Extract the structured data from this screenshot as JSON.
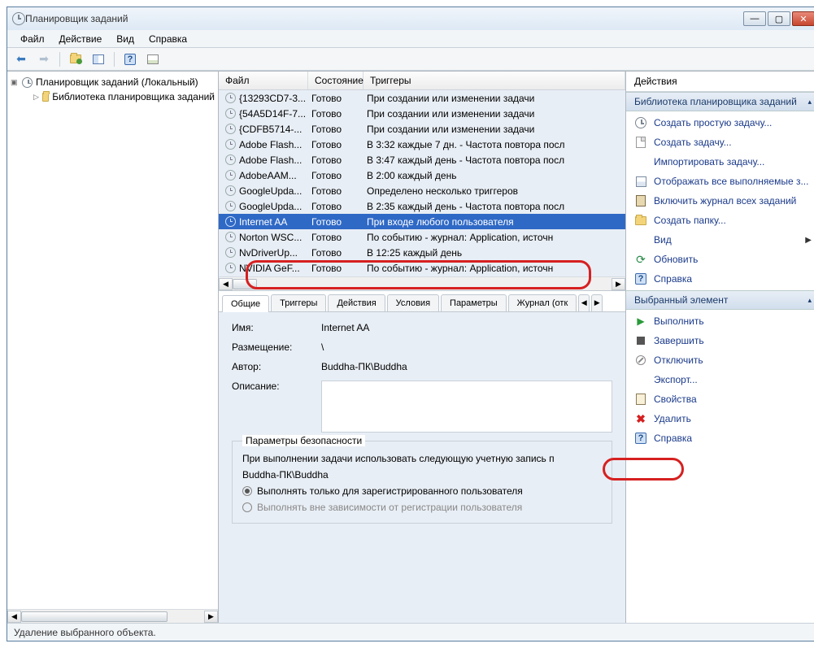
{
  "window": {
    "title": "Планировщик заданий"
  },
  "menu": {
    "file": "Файл",
    "action": "Действие",
    "view": "Вид",
    "help": "Справка"
  },
  "tree": {
    "root": "Планировщик заданий (Локальный)",
    "library": "Библиотека планировщика заданий"
  },
  "list": {
    "columns": {
      "file": "Файл",
      "state": "Состояние",
      "triggers": "Триггеры"
    },
    "rows": [
      {
        "file": "{13293CD7-3...",
        "state": "Готово",
        "trigger": "При создании или изменении задачи",
        "selected": false
      },
      {
        "file": "{54A5D14F-7...",
        "state": "Готово",
        "trigger": "При создании или изменении задачи",
        "selected": false
      },
      {
        "file": "{CDFB5714-...",
        "state": "Готово",
        "trigger": "При создании или изменении задачи",
        "selected": false
      },
      {
        "file": "Adobe Flash...",
        "state": "Готово",
        "trigger": "В 3:32 каждые 7 дн. - Частота повтора посл",
        "selected": false
      },
      {
        "file": "Adobe Flash...",
        "state": "Готово",
        "trigger": "В 3:47 каждый день - Частота повтора посл",
        "selected": false
      },
      {
        "file": "AdobeAAM...",
        "state": "Готово",
        "trigger": "В 2:00 каждый день",
        "selected": false
      },
      {
        "file": "GoogleUpda...",
        "state": "Готово",
        "trigger": "Определено несколько триггеров",
        "selected": false
      },
      {
        "file": "GoogleUpda...",
        "state": "Готово",
        "trigger": "В 2:35 каждый день - Частота повтора посл",
        "selected": false
      },
      {
        "file": "Internet AA",
        "state": "Готово",
        "trigger": "При входе любого пользователя",
        "selected": true
      },
      {
        "file": "Norton WSC...",
        "state": "Готово",
        "trigger": "По событию - журнал: Application, источн",
        "selected": false
      },
      {
        "file": "NvDriverUp...",
        "state": "Готово",
        "trigger": "В 12:25 каждый день",
        "selected": false
      },
      {
        "file": "NVIDIA GeF...",
        "state": "Готово",
        "trigger": "По событию - журнал: Application, источн",
        "selected": false
      }
    ]
  },
  "detail": {
    "tabs": [
      "Общие",
      "Триггеры",
      "Действия",
      "Условия",
      "Параметры",
      "Журнал (отк"
    ],
    "labels": {
      "name": "Имя:",
      "location": "Размещение:",
      "author": "Автор:",
      "description": "Описание:"
    },
    "values": {
      "name": "Internet AA",
      "location": "\\",
      "author": "Buddha-ПК\\Buddha"
    },
    "security": {
      "legend": "Параметры безопасности",
      "account_label": "При выполнении задачи использовать следующую учетную запись п",
      "account": "Buddha-ПК\\Buddha",
      "radio_logged_on": "Выполнять только для зарегистрированного пользователя",
      "radio_any": "Выполнять вне зависимости от регистрации пользователя"
    }
  },
  "actions": {
    "title": "Действия",
    "section_library": "Библиотека планировщика заданий",
    "section_selected": "Выбранный элемент",
    "library_items": [
      {
        "icon": "clock",
        "label": "Создать простую задачу..."
      },
      {
        "icon": "sheet-new",
        "label": "Создать задачу..."
      },
      {
        "icon": "none",
        "label": "Импортировать задачу..."
      },
      {
        "icon": "grid",
        "label": "Отображать все выполняемые з..."
      },
      {
        "icon": "book",
        "label": "Включить журнал всех заданий"
      },
      {
        "icon": "folder",
        "label": "Создать папку..."
      },
      {
        "icon": "none",
        "label": "Вид",
        "submenu": true
      },
      {
        "icon": "refresh",
        "label": "Обновить"
      },
      {
        "icon": "help",
        "label": "Справка"
      }
    ],
    "selected_items": [
      {
        "icon": "run",
        "label": "Выполнить"
      },
      {
        "icon": "stop",
        "label": "Завершить"
      },
      {
        "icon": "disable",
        "label": "Отключить"
      },
      {
        "icon": "none",
        "label": "Экспорт..."
      },
      {
        "icon": "props",
        "label": "Свойства"
      },
      {
        "icon": "delete",
        "label": "Удалить"
      },
      {
        "icon": "help",
        "label": "Справка"
      }
    ]
  },
  "statusbar": {
    "text": "Удаление выбранного объекта."
  }
}
